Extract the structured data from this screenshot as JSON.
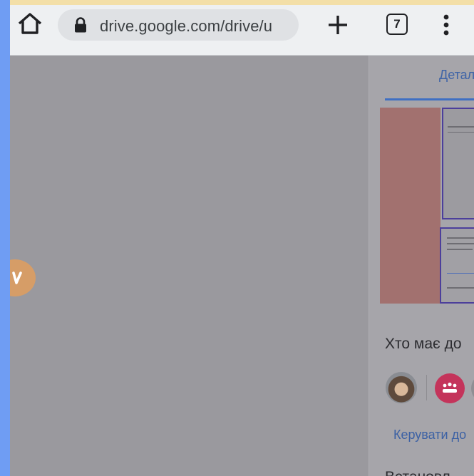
{
  "browser": {
    "url": "drive.google.com/drive/u",
    "tab_count": "7"
  },
  "details_panel": {
    "tab_label": "Детал",
    "who_has_access": "Хто має до",
    "manage_access_link": "Керувати до",
    "next_section_heading": "Встановл"
  },
  "colors": {
    "accent": "#3f64a7",
    "domain_avatar": "#c4345b",
    "rail": "#6f9df3"
  }
}
